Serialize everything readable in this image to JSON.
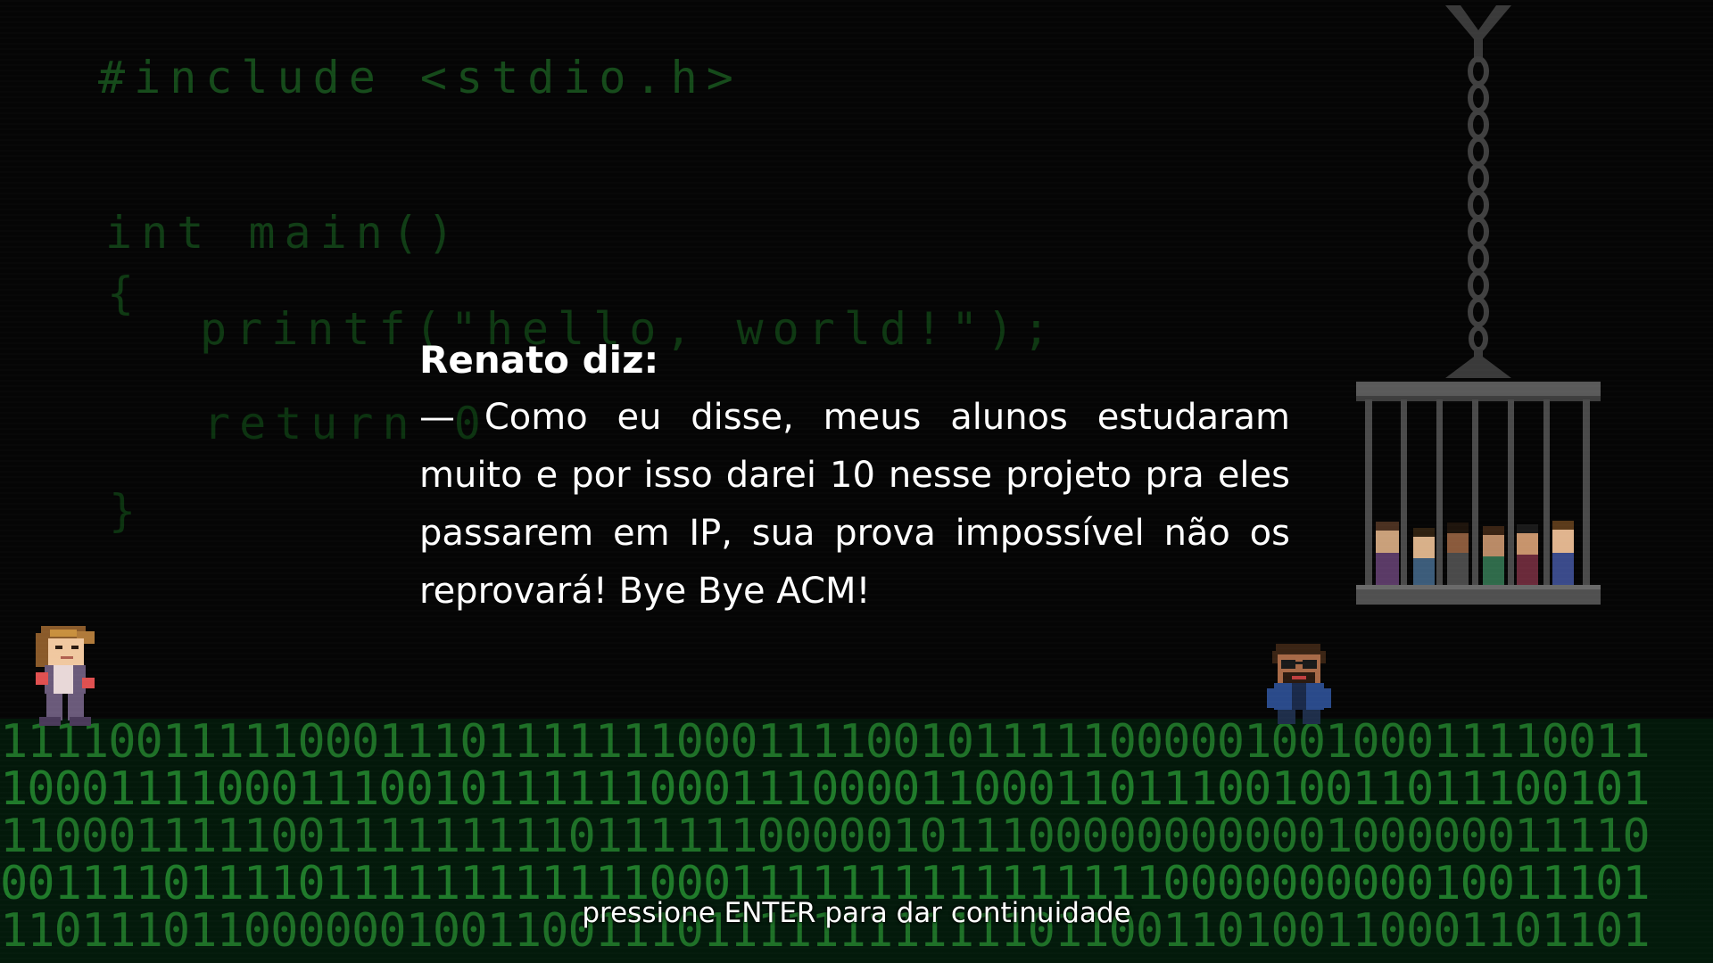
{
  "scene": {
    "background_color": "#050505",
    "code_color": "#154a1a",
    "binary_color": "#1f7a2a"
  },
  "code_lines": [
    "#include <stdio.h>",
    "int main()",
    "{",
    "printf(\"hello, world!\");",
    "return 0",
    "}"
  ],
  "dialog": {
    "speaker": "Renato diz:",
    "text": "— Como eu disse, meus alunos estudaram muito e por isso darei 10 nesse projeto pra eles passarem em IP, sua prova impossível não os reprovará! Bye Bye ACM!"
  },
  "binary_rows": [
    "1111001111100011101111111000111100101111100000100100011110011",
    "1000111100011100101111110001110000110001101110010011011100101",
    "1100011111001111111110111111000001011100000000000100000011110",
    "0011110111101111111111110001111111111111111000000000010011101",
    "1101110110000001001100111011111111111101100110100110001101101"
  ],
  "prompt": "pressione ENTER para dar continuidade",
  "characters": [
    {
      "name": "player",
      "icon": "player-sprite"
    },
    {
      "name": "renato",
      "icon": "villain-sprite"
    }
  ],
  "cage": {
    "icon": "hanging-cage",
    "captives": 6
  }
}
